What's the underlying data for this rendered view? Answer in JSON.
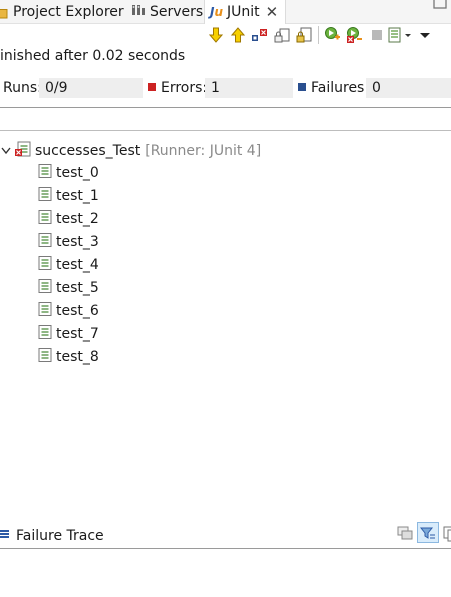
{
  "tabs": [
    {
      "label": "Project Explorer",
      "icon": "project-explorer-icon",
      "active": false
    },
    {
      "label": "Servers",
      "icon": "servers-icon",
      "active": false
    },
    {
      "label": "JUnit",
      "icon": "junit-icon",
      "active": true,
      "close": "✕"
    }
  ],
  "toolbar": {
    "buttons": [
      "next-failure-icon",
      "previous-failure-icon",
      "show-failures-only-icon",
      "scroll-lock-icon",
      "lock-icon",
      "rerun-test-icon",
      "rerun-failed-first-icon",
      "stop-icon",
      "test-history-icon",
      "view-menu-icon"
    ]
  },
  "status_text": "inished after 0.02 seconds",
  "counters": {
    "runs_label": "Runs:",
    "runs_value": "0/9",
    "errors_label": "Errors:",
    "errors_value": "1",
    "failures_label": "Failures:",
    "failures_value": "0"
  },
  "tree": {
    "root_label": "successes_Test",
    "root_runner": "[Runner: JUnit 4]",
    "items": [
      "test_0",
      "test_1",
      "test_2",
      "test_3",
      "test_4",
      "test_5",
      "test_6",
      "test_7",
      "test_8"
    ]
  },
  "failure_trace": {
    "title": "Failure Trace"
  },
  "colors": {
    "error_red": "#cc2222",
    "failure_blue": "#2a4f8f",
    "tree_icon_green": "#4a8a3a",
    "junit_blue": "#2d5aa6",
    "junit_orange": "#e8901c"
  }
}
